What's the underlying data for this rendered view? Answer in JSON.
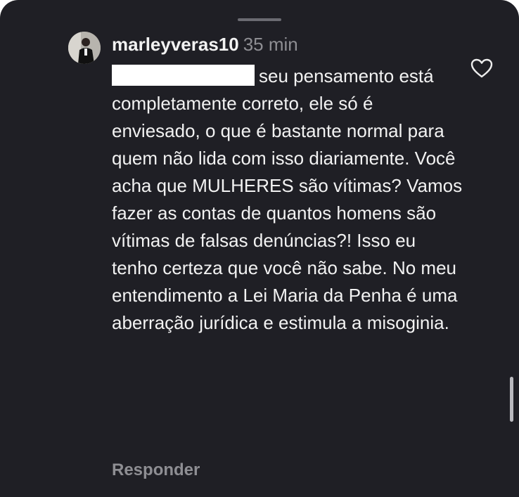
{
  "comment": {
    "username": "marleyveras10",
    "timestamp": "35 min",
    "text_after_redaction": "seu pensamento está completamente correto, ele só é enviesado, o que é bastante normal para quem não lida com isso diariamente. Você acha que MULHERES são vítimas? Vamos fazer as contas de quantos homens são vítimas de falsas denúncias?! Isso eu tenho certeza que você não sabe. No meu entendimento a Lei Maria da Penha é uma aberração jurídica e estimula a misoginia.",
    "reply_label": "Responder"
  },
  "icons": {
    "like": "heart-outline-icon"
  },
  "colors": {
    "background": "#1f1f25",
    "text": "#f2f2f2",
    "secondary_text": "#8e8e93",
    "redaction": "#ffffff"
  }
}
